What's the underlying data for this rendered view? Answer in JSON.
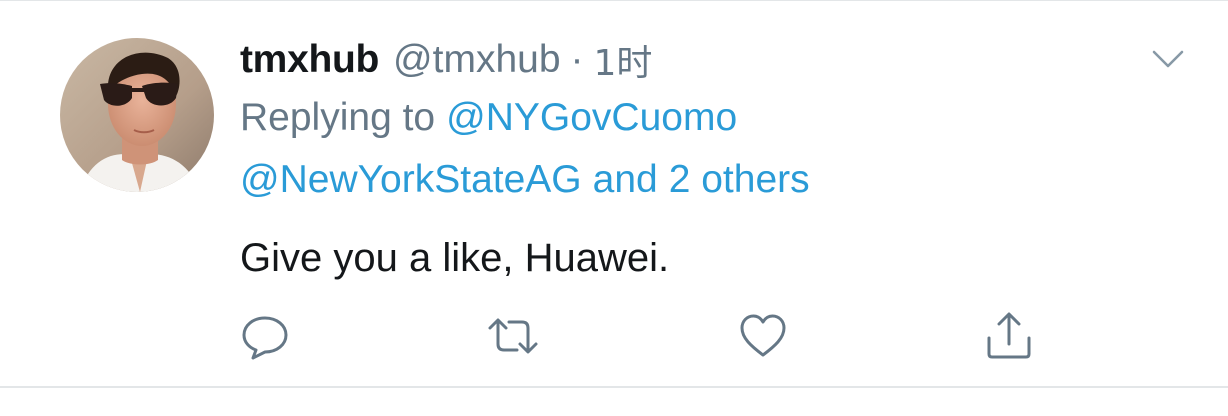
{
  "tweet": {
    "display_name": "tmxhub",
    "handle": "@tmxhub",
    "separator": "·",
    "time": "1时",
    "reply_prefix": "Replying to",
    "reply_user_1": "@NYGovCuomo",
    "reply_user_2": "@NewYorkStateAG",
    "reply_and": "and",
    "reply_others": "2 others",
    "text": "Give you a like, Huawei."
  },
  "icons": {
    "caret": "chevron-down-icon",
    "reply": "reply-icon",
    "retweet": "retweet-icon",
    "like": "heart-icon",
    "share": "share-icon"
  },
  "colors": {
    "text_primary": "#14171a",
    "text_secondary": "#657786",
    "link": "#2a9bd7",
    "icon": "#657786",
    "divider": "#e3e6e8"
  }
}
